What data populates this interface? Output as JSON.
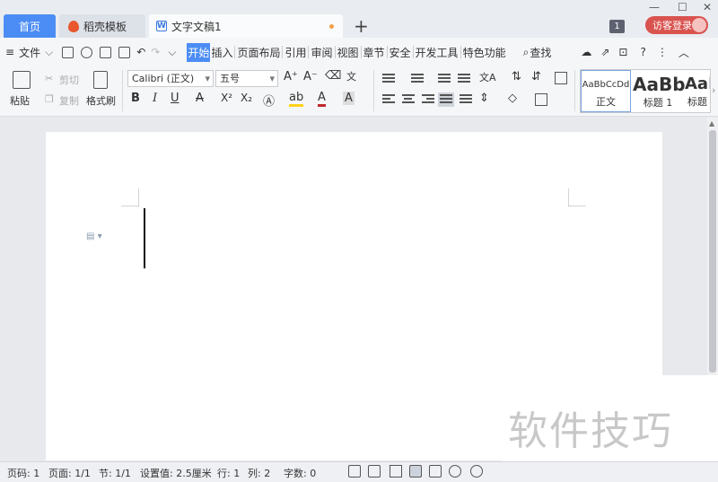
{
  "tabs": {
    "home": "首页",
    "templates": "稻壳模板",
    "document": "文字文稿1",
    "new_tab": "+"
  },
  "titlebar": {
    "window_badge": "1",
    "login": "访客登录",
    "minimize": "—",
    "maximize": "☐",
    "close": "✕"
  },
  "menubar": {
    "file": "文件",
    "items": [
      "开始",
      "插入",
      "页面布局",
      "引用",
      "审阅",
      "视图",
      "章节",
      "安全",
      "开发工具",
      "特色功能"
    ],
    "active_index": 0,
    "search": "查找",
    "help": "?"
  },
  "ribbon": {
    "paste": "粘贴",
    "cut": "剪切",
    "copy": "复制",
    "format_painter": "格式刷",
    "font_name": "Calibri (正文)",
    "font_size": "五号",
    "bold": "B",
    "italic": "I",
    "underline": "U",
    "strike": "A",
    "superscript": "X²",
    "subscript": "X₂",
    "font_grow": "A⁺",
    "font_shrink": "A⁻",
    "styles": [
      {
        "preview": "AaBbCcDd",
        "name": "正文"
      },
      {
        "preview": "AaBb",
        "name": "标题 1"
      },
      {
        "preview": "AaI",
        "name": "标题"
      }
    ]
  },
  "statusbar": {
    "page_no": "页码: 1",
    "pages": "页面: 1/1",
    "section": "节: 1/1",
    "setting": "设置值: 2.5厘米",
    "row": "行: 1",
    "col": "列: 2",
    "words": "字数: 0"
  },
  "watermark": "软件技巧",
  "colors": {
    "accent": "#4c8df5",
    "login": "#d9534f",
    "modified_dot": "#f2a048"
  }
}
